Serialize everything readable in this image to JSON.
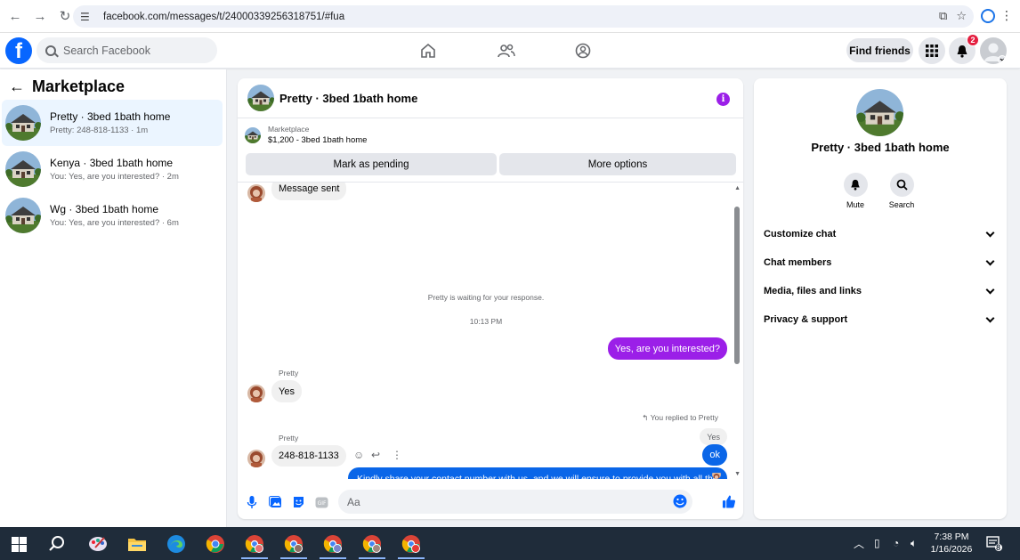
{
  "browser": {
    "url": "facebook.com/messages/t/24000339256318751/#fua"
  },
  "fb_nav": {
    "search_placeholder": "Search Facebook",
    "find_friends": "Find friends",
    "notification_count": "2",
    "brand_color": "#0866ff"
  },
  "sidebar": {
    "title": "Marketplace",
    "conversations": [
      {
        "name": "Pretty · 3bed 1bath home",
        "subtitle": "Pretty: 248-818-1133 · 1m",
        "active": true
      },
      {
        "name": "Kenya · 3bed 1bath home",
        "subtitle": "You: Yes, are you interested? · 2m",
        "active": false
      },
      {
        "name": "Wg · 3bed 1bath home",
        "subtitle": "You: Yes, are you interested? · 6m",
        "active": false
      }
    ]
  },
  "chat": {
    "title": "Pretty · 3bed 1bath home",
    "listing_source": "Marketplace",
    "listing_title": "$1,200 - 3bed 1bath home",
    "mark_pending": "Mark as pending",
    "more_options": "More options",
    "messages": {
      "m1": "Message sent",
      "waiting": "Pretty is waiting for your response.",
      "timestamp": "10:13 PM",
      "out1": "Yes, are you interested?",
      "sender1": "Pretty",
      "in1": "Yes",
      "replied_note": "You replied to Pretty",
      "quoted": "Yes",
      "out2": "ok",
      "out3": "Kindly share your contact number with us, and we will ensure to provide you with all the necessary information directly on your number.",
      "sender2": "Pretty",
      "in2": "248-818-1133"
    },
    "composer_placeholder": "Aa"
  },
  "right_panel": {
    "name": "Pretty · 3bed 1bath home",
    "mute": "Mute",
    "search": "Search",
    "sections": [
      "Customize chat",
      "Chat members",
      "Media, files and links",
      "Privacy & support"
    ]
  },
  "taskbar": {
    "time": "7:38 PM",
    "date": "1/16/2026",
    "notif_count": "8"
  }
}
